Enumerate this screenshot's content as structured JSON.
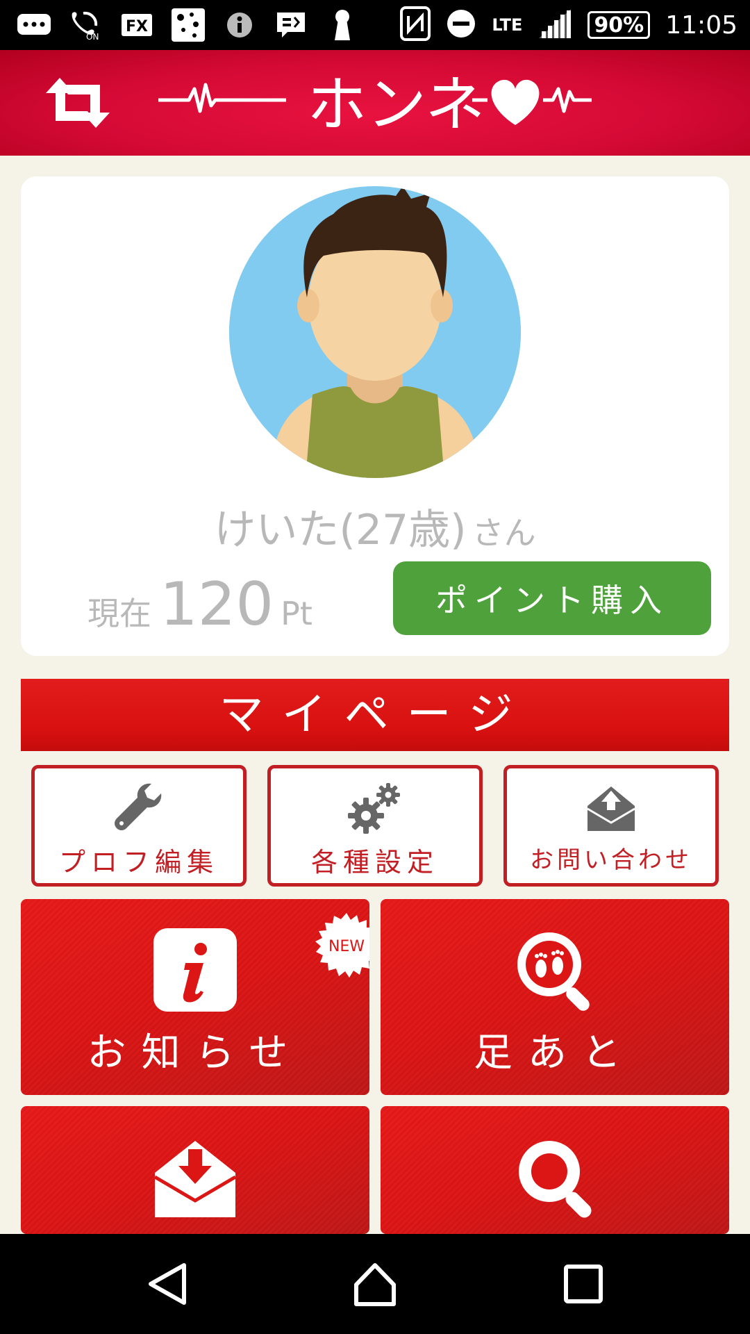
{
  "status_bar": {
    "network": "LTE",
    "battery": "90%",
    "time": "11:05",
    "icons": [
      "chat-bubble-icon",
      "wifi-calling-icon",
      "fx-app-icon",
      "connect-app-icon",
      "info-icon",
      "message-icon",
      "keyhole-icon",
      "nfc-icon",
      "do-not-disturb-icon",
      "signal-icon",
      "battery-icon"
    ]
  },
  "header": {
    "logo_text": "ホンネ",
    "icons": [
      "swap-arrows-icon",
      "heartbeat-heart-icon"
    ]
  },
  "profile": {
    "name": "けいた(27歳)",
    "honorific": "さん",
    "points_prefix": "現在",
    "points_value": "120",
    "points_unit": "Pt",
    "buy_label": "ポイント購入"
  },
  "mypage": {
    "title": "マイページ"
  },
  "small_buttons": [
    {
      "label": "プロフ編集",
      "icon": "wrench-icon"
    },
    {
      "label": "各種設定",
      "icon": "gears-icon"
    },
    {
      "label": "お問い合わせ",
      "icon": "mail-upload-icon"
    }
  ],
  "tiles": [
    {
      "label": "お知らせ",
      "icon": "info-icon",
      "badge": "NEW"
    },
    {
      "label": "足あと",
      "icon": "footprints-search-icon"
    },
    {
      "label": "",
      "icon": "mail-download-icon"
    },
    {
      "label": "",
      "icon": "search-icon"
    }
  ],
  "colors": {
    "header_red": "#d50a35",
    "tile_red": "#dc1515",
    "button_green": "#4fa23b",
    "border_red": "#c21f24",
    "background": "#f5f2e8",
    "gray_text": "#b8b8b8"
  }
}
